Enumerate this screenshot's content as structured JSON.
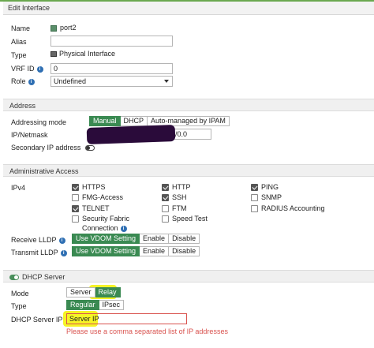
{
  "dialog": {
    "title": "Edit Interface"
  },
  "general": {
    "name_label": "Name",
    "name_value": "port2",
    "alias_label": "Alias",
    "alias_value": "",
    "type_label": "Type",
    "type_value": "Physical Interface",
    "vrf_label": "VRF ID",
    "vrf_value": "0",
    "role_label": "Role",
    "role_value": "Undefined"
  },
  "address": {
    "section_title": "Address",
    "mode_label": "Addressing mode",
    "mode_options": [
      "Manual",
      "DHCP",
      "Auto-managed by IPAM"
    ],
    "mode_selected": "Manual",
    "ipmask_label": "IP/Netmask",
    "ipmask_visible_tail": "/0.0",
    "secondary_label": "Secondary IP address"
  },
  "admin_access": {
    "section_title": "Administrative Access",
    "ipv4_label": "IPv4",
    "items": [
      {
        "label": "HTTPS",
        "checked": true
      },
      {
        "label": "HTTP",
        "checked": true
      },
      {
        "label": "PING",
        "checked": true
      },
      {
        "label": "FMG-Access",
        "checked": false
      },
      {
        "label": "SSH",
        "checked": true
      },
      {
        "label": "SNMP",
        "checked": false
      },
      {
        "label": "TELNET",
        "checked": true
      },
      {
        "label": "FTM",
        "checked": false
      },
      {
        "label": "RADIUS Accounting",
        "checked": false
      },
      {
        "label": "Security Fabric",
        "checked": false
      },
      {
        "label": "Speed Test",
        "checked": false
      }
    ],
    "connection_label": "Connection",
    "receive_lldp_label": "Receive LLDP",
    "transmit_lldp_label": "Transmit LLDP",
    "lldp_options": [
      "Use VDOM Setting",
      "Enable",
      "Disable"
    ],
    "lldp_selected": "Use VDOM Setting"
  },
  "dhcp": {
    "section_title": "DHCP Server",
    "mode_label": "Mode",
    "mode_options": [
      "Server",
      "Relay"
    ],
    "mode_selected": "Relay",
    "type_label": "Type",
    "type_options": [
      "Regular",
      "IPsec"
    ],
    "type_selected": "Regular",
    "server_ip_label": "DHCP Server IP",
    "server_ip_value": "Server IP",
    "error_text": "Please use a comma separated list of IP addresses"
  },
  "colors": {
    "accent": "#3a8a52",
    "error": "#d9534f",
    "highlight": "#f5f200",
    "redaction": "#2a0b3a"
  },
  "icons": {
    "name": "port-icon",
    "type": "physical-interface-icon",
    "info": "info-icon",
    "caret": "chevron-down-icon"
  }
}
